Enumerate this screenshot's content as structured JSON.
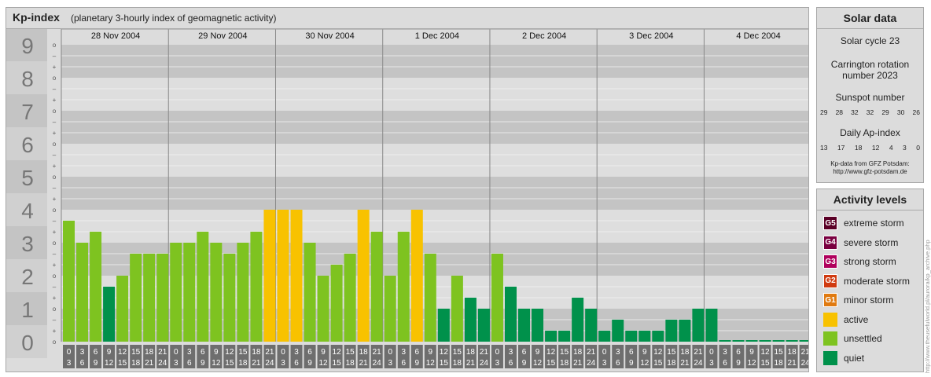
{
  "header": {
    "title": "Kp-index",
    "subtitle": "(planetary 3-hourly index of geomagnetic activity)"
  },
  "chart_data": {
    "type": "bar",
    "ylim": [
      0,
      9
    ],
    "y_ticks": [
      "0",
      "1",
      "2",
      "3",
      "4",
      "5",
      "6",
      "7",
      "8",
      "9"
    ],
    "minor_ticks": [
      "o",
      "+",
      "–",
      "o"
    ],
    "days": [
      "28 Nov 2004",
      "29 Nov 2004",
      "30 Nov 2004",
      "1 Dec 2004",
      "2 Dec 2004",
      "3 Dec 2004",
      "4 Dec 2004"
    ],
    "interval_start": [
      "0",
      "3",
      "6",
      "9",
      "12",
      "15",
      "18",
      "21"
    ],
    "interval_end": [
      "3",
      "6",
      "9",
      "12",
      "15",
      "18",
      "21",
      "24"
    ],
    "values": [
      3.667,
      3.0,
      3.333,
      1.667,
      2.0,
      2.667,
      2.667,
      2.667,
      3.0,
      3.0,
      3.333,
      3.0,
      2.667,
      3.0,
      3.333,
      4.0,
      4.0,
      4.0,
      3.0,
      2.0,
      2.333,
      2.667,
      4.0,
      3.333,
      2.0,
      3.333,
      4.0,
      2.667,
      1.0,
      2.0,
      1.333,
      1.0,
      2.667,
      1.667,
      1.0,
      1.0,
      0.333,
      0.333,
      1.333,
      1.0,
      0.333,
      0.667,
      0.333,
      0.333,
      0.333,
      0.667,
      0.667,
      1.0,
      1.0,
      0.0,
      0.0,
      0.0,
      0.0,
      0.0,
      0.0,
      0.0,
      0.0
    ],
    "colors": {
      "active": "#f8c200",
      "unsettled": "#7ec320",
      "quiet": "#00914b",
      "band_dark": "#c4c4c4",
      "band_light": "#dedede",
      "interval_label_bg": "#6e6e6e"
    }
  },
  "solar": {
    "title": "Solar data",
    "cycle": "Solar cycle 23",
    "carrington_line1": "Carrington rotation",
    "carrington_line2": "number 2023",
    "sunspot_label": "Sunspot number",
    "sunspot_values": [
      "29",
      "28",
      "32",
      "32",
      "29",
      "30",
      "26"
    ],
    "ap_label": "Daily Ap-index",
    "ap_values": [
      "13",
      "17",
      "18",
      "12",
      "4",
      "3",
      "0"
    ],
    "credit_line1": "Kp-data from GFZ Potsdam:",
    "credit_line2": "http://www.gfz-potsdam.de"
  },
  "levels": {
    "title": "Activity levels",
    "items": [
      {
        "badge": "G5",
        "label": "extreme storm",
        "color": "#5a0026"
      },
      {
        "badge": "G4",
        "label": "severe storm",
        "color": "#7a0040"
      },
      {
        "badge": "G3",
        "label": "strong storm",
        "color": "#b0005c"
      },
      {
        "badge": "G2",
        "label": "moderate storm",
        "color": "#d03a10"
      },
      {
        "badge": "G1",
        "label": "minor storm",
        "color": "#e07a10"
      },
      {
        "badge": "",
        "label": "active",
        "color": "#f8c200"
      },
      {
        "badge": "",
        "label": "unsettled",
        "color": "#7ec320"
      },
      {
        "badge": "",
        "label": "quiet",
        "color": "#00914b"
      }
    ]
  },
  "watermark": "http://www.theusefulworld.pl/aurora/kp_archive.php"
}
